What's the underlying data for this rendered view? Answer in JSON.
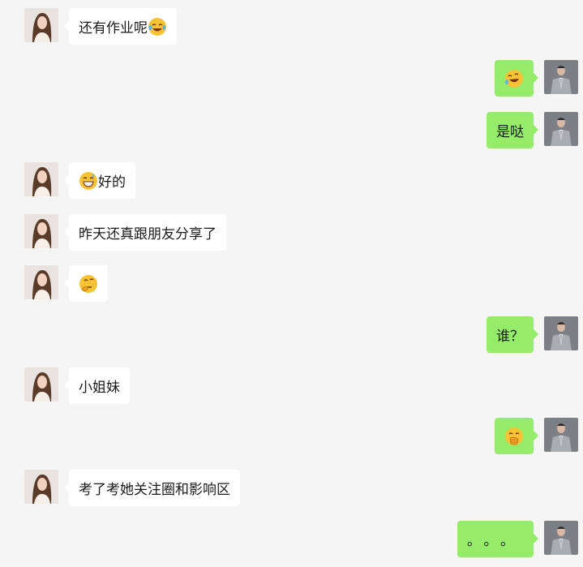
{
  "messages": [
    {
      "side": "left",
      "text": "还有作业呢",
      "emoji": "laugh-tears-emoji",
      "emoji_pos": "after"
    },
    {
      "side": "right",
      "text": "",
      "emoji": "rolling-laugh-emoji"
    },
    {
      "side": "right",
      "text": "是哒"
    },
    {
      "side": "left",
      "text": "好的",
      "emoji": "grinning-sweat-emoji",
      "emoji_pos": "before"
    },
    {
      "side": "left",
      "text": "昨天还真跟朋友分享了"
    },
    {
      "side": "left",
      "text": "",
      "emoji": "thinking-emoji"
    },
    {
      "side": "right",
      "text": "谁？"
    },
    {
      "side": "left",
      "text": "小姐妹"
    },
    {
      "side": "right",
      "text": "",
      "emoji": "hand-over-mouth-emoji"
    },
    {
      "side": "left",
      "text": "考了考她关注圈和影响区"
    },
    {
      "side": "right",
      "text": "。。。"
    }
  ],
  "avatars": {
    "left": "female-contact-avatar",
    "right": "male-user-avatar"
  },
  "colors": {
    "background": "#f5f5f5",
    "incoming_bubble": "#ffffff",
    "outgoing_bubble": "#95ec69"
  }
}
